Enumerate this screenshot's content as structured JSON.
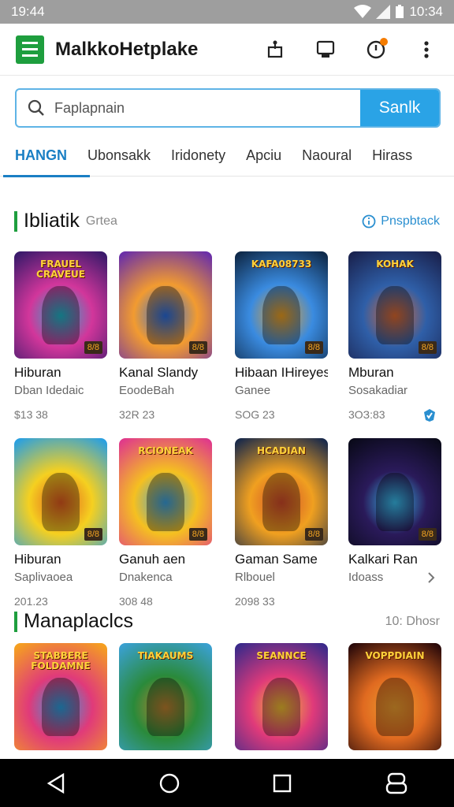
{
  "status_bar": {
    "time_left": "19:44",
    "time_right": "10:34"
  },
  "app_bar": {
    "title": "MalkkoHetplake"
  },
  "search": {
    "placeholder": "Faplapnain",
    "button_label": "Sanlk"
  },
  "tabs": [
    {
      "label": "HANGN",
      "active": true
    },
    {
      "label": "Ubonsakk"
    },
    {
      "label": "Iridonety"
    },
    {
      "label": "Apciu"
    },
    {
      "label": "Naoural"
    },
    {
      "label": "Hirass"
    }
  ],
  "section1": {
    "title": "Ibliatik",
    "subtitle": "Grtea",
    "link": "Pnspbtack"
  },
  "row1": [
    {
      "name": "Hiburan",
      "category": "Dban Idedaic",
      "price": "$13 38",
      "badge": "8/8",
      "art_text": "FRAUEL CRAVEUE",
      "colors": [
        "#3a1a6b",
        "#d2369b",
        "#1fb6c9"
      ]
    },
    {
      "name": "Kanal Slandy",
      "category": "EoodeBah",
      "price": "32R 23",
      "badge": "8/8",
      "art_text": "",
      "colors": [
        "#6a2fa8",
        "#f29b30",
        "#2a6de0"
      ]
    },
    {
      "name": "Hibaan IHireyest",
      "category": "Ganee",
      "price": "SOG 23",
      "badge": "8/8",
      "art_text": "KAFA08733",
      "colors": [
        "#0f2a4a",
        "#3a8be0",
        "#f0a020"
      ]
    },
    {
      "name": "Mburan",
      "category": "Sosakadiar",
      "price": "3ОЗ:83",
      "badge": "8/8",
      "art_text": "KOHAK",
      "colors": [
        "#1a2350",
        "#2f5fa8",
        "#e06a30"
      ]
    }
  ],
  "row2": [
    {
      "name": "Hiburan",
      "category": "Saplivaoea",
      "price": "201.23",
      "badge": "8/8",
      "art_text": "",
      "colors": [
        "#2aa0e0",
        "#f5d020",
        "#e05a20"
      ]
    },
    {
      "name": "Ganuh aen",
      "category": "Dnakenca",
      "price": "308 48",
      "badge": "8/8",
      "art_text": "RCIONEAK",
      "colors": [
        "#e03a8a",
        "#f5c020",
        "#3aa0e0"
      ]
    },
    {
      "name": "Gaman Same",
      "category": "Rlbouel",
      "price": "2098 33",
      "badge": "8/8",
      "art_text": "HCADIAN",
      "colors": [
        "#1a2a4a",
        "#f0a020",
        "#d04a2a"
      ]
    },
    {
      "name": "Kalkari Ran",
      "category": "Idoass",
      "price": "",
      "badge": "8/8",
      "art_text": "",
      "colors": [
        "#0a0a1a",
        "#2a1a5a",
        "#3ac0f0"
      ]
    }
  ],
  "section2": {
    "title": "Manaplaclcs",
    "more": "10: Dhosr"
  },
  "row3": [
    {
      "art_text": "STABBERE FOLDAMNE",
      "colors": [
        "#f5a020",
        "#e03a7a",
        "#2aa0e0"
      ]
    },
    {
      "art_text": "TIAKAUMS",
      "colors": [
        "#3aa0d0",
        "#2a8a3a",
        "#c08030"
      ]
    },
    {
      "art_text": "SEANNCE",
      "colors": [
        "#3a2a8a",
        "#e03a7a",
        "#f0c030"
      ]
    },
    {
      "art_text": "VOPPDIAIN",
      "colors": [
        "#2a0a0a",
        "#e06a20",
        "#f0a030"
      ]
    }
  ],
  "icons": {
    "status": [
      "wifi-icon",
      "signal-icon",
      "battery-icon"
    ],
    "app_bar": [
      "menu-icon",
      "share-icon",
      "cast-icon",
      "notification-icon",
      "more-icon"
    ],
    "nav": [
      "back-icon",
      "home-icon",
      "recents-icon",
      "assistant-icon"
    ]
  },
  "accent": "#1e9e3e",
  "primary": "#2aa3e6"
}
